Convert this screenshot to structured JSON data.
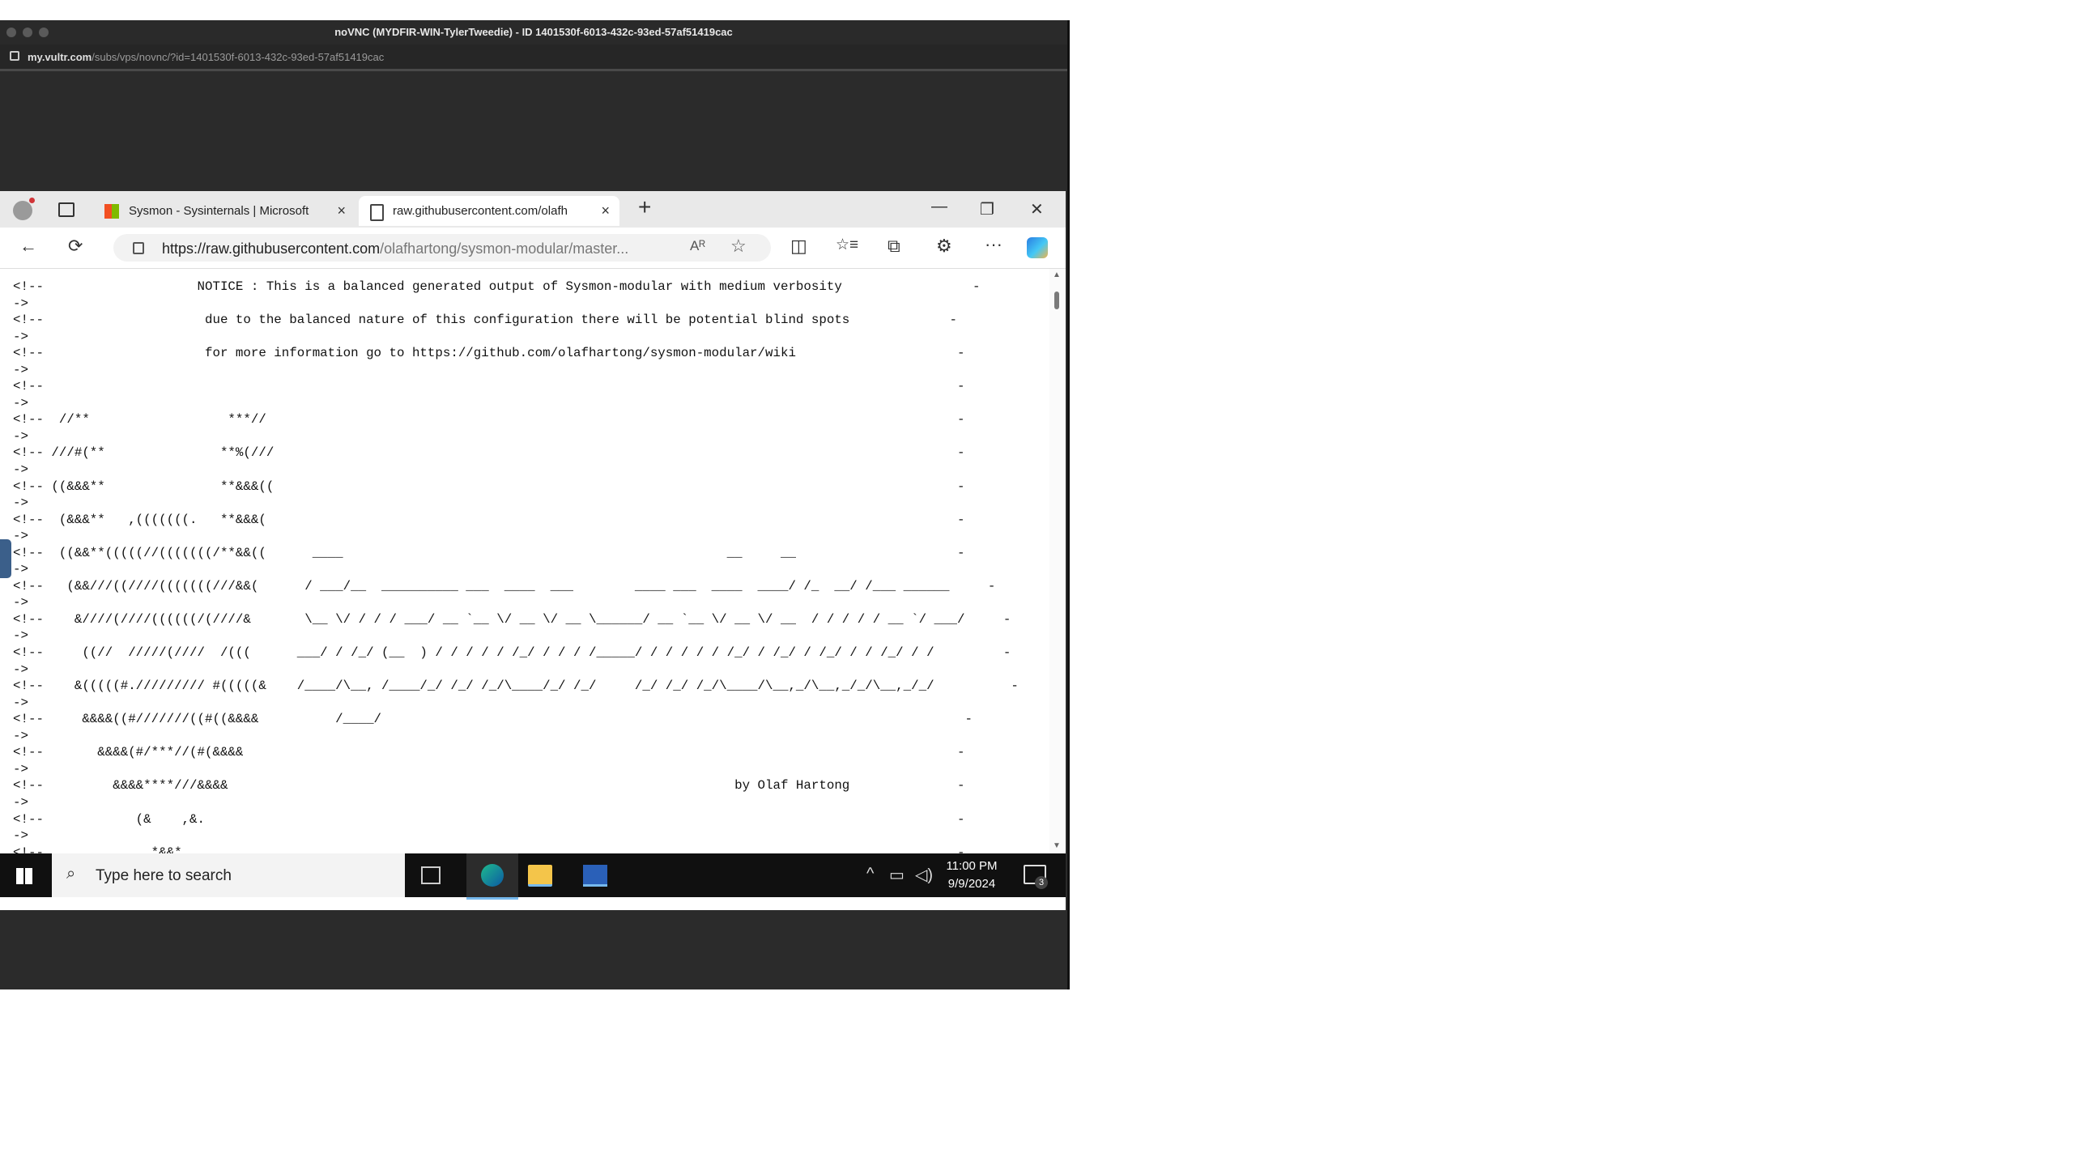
{
  "window": {
    "title": "noVNC (MYDFIR-WIN-TylerTweedie) - ID 1401530f-6013-432c-93ed-57af51419cac",
    "url_domain": "my.vultr.com",
    "url_path": "/subs/vps/novnc/?id=1401530f-6013-432c-93ed-57af51419cac"
  },
  "browser": {
    "tabs": [
      {
        "label": "Sysmon - Sysinternals | Microsoft",
        "close": "×"
      },
      {
        "label": "raw.githubusercontent.com/olafh",
        "close": "×"
      }
    ],
    "new_tab": "+",
    "controls": {
      "minimize": "—",
      "maximize": "❐",
      "close": "✕"
    },
    "address": {
      "prefix": "https://raw.githubusercontent.com",
      "path": "/olafhartong/sysmon-modular/master..."
    },
    "icons": {
      "back": "←",
      "refresh": "⟳",
      "read_aloud": "Aᴿ",
      "favorite": "☆",
      "split": "◫",
      "favorites": "☆≡",
      "collections": "⧉",
      "extensions": "⚙",
      "more": "···"
    }
  },
  "page": {
    "lines": [
      "<!--                    NOTICE : This is a balanced generated output of Sysmon-modular with medium verbosity                 -",
      "->",
      "<!--                     due to the balanced nature of this configuration there will be potential blind spots             -",
      "->",
      "<!--                     for more information go to https://github.com/olafhartong/sysmon-modular/wiki                     -",
      "->",
      "<!--                                                                                                                       -",
      "->",
      "<!--  //**                  ***//                                                                                          -",
      "->",
      "<!-- ///#(**               **%(///                                                                                         -",
      "->",
      "<!-- ((&&&**               **&&&((                                                                                         -",
      "->",
      "<!--  (&&&**   ,(((((((.   **&&&(                                                                                          -",
      "->",
      "<!--  ((&&**(((((//(((((((/**&&((      ____                                                  __     __                     -",
      "->",
      "<!--   (&&///((////(((((((///&&(      / ___/__  __________ ___  ____  ___        ____ ___  ____  ____/ /_  __/ /___ ______     -",
      "->",
      "<!--    &////(////((((((/(////&       \\__ \\/ / / / ___/ __ `__ \\/ __ \\/ __ \\______/ __ `__ \\/ __ \\/ __  / / / / / __ `/ ___/     -",
      "->",
      "<!--     ((//  /////(////  /(((      ___/ / /_/ (__  ) / / / / / /_/ / / / /_____/ / / / / / /_/ / /_/ / /_/ / / /_/ / /         -",
      "->",
      "<!--    &(((((#.///////// #(((((&    /____/\\__, /____/_/ /_/ /_/\\____/_/ /_/     /_/ /_/ /_/\\____/\\__,_/\\__,_/_/\\__,_/_/          -",
      "->",
      "<!--     &&&&((#///////((#((&&&&          /____/                                                                            -",
      "->",
      "<!--       &&&&(#/***//(#(&&&&                                                                                             -",
      "->",
      "<!--         &&&&****///&&&&                                                                  by Olaf Hartong              -",
      "->",
      "<!--            (&    ,&.                                                                                                  -",
      "->",
      "<!--              *&&*                                                                                                     -"
    ]
  },
  "taskbar": {
    "search_placeholder": "Type here to search",
    "time": "11:00 PM",
    "date": "9/9/2024",
    "notification_count": "3"
  }
}
